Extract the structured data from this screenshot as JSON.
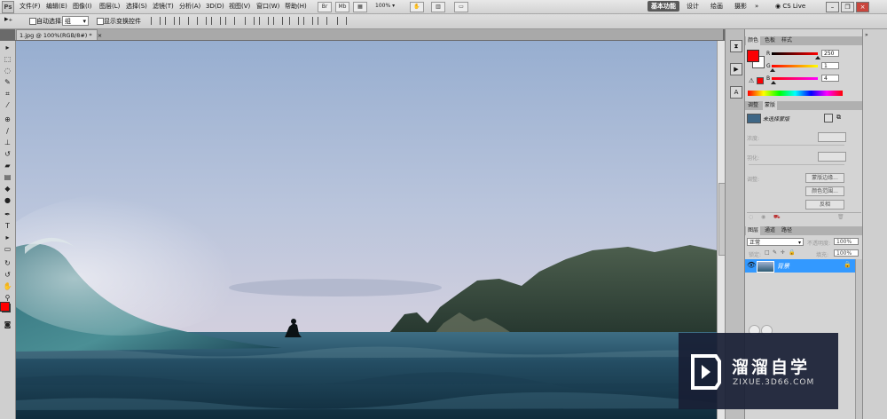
{
  "menubar": {
    "logo": "Ps",
    "menus": [
      "文件(F)",
      "编辑(E)",
      "图像(I)",
      "图层(L)",
      "选择(S)",
      "滤镜(T)",
      "分析(A)",
      "3D(D)",
      "视图(V)",
      "窗口(W)",
      "帮助(H)"
    ],
    "br_label": "Br",
    "mb_label": "Mb",
    "zoom": "100%",
    "workspaces": [
      "基本功能",
      "设计",
      "绘画",
      "摄影"
    ],
    "more": "»",
    "cs_live": "CS Live"
  },
  "options": {
    "auto_select_label": "自动选择:",
    "auto_select_value": "组",
    "show_transform_label": "显示变换控件"
  },
  "document": {
    "tab_title": "1.jpg @ 100%(RGB/8#) *",
    "tab_close": "×"
  },
  "color_panel": {
    "tabs": [
      "颜色",
      "色板",
      "样式"
    ],
    "channels": [
      {
        "label": "R",
        "value": "250",
        "pos": 1.0
      },
      {
        "label": "G",
        "value": "1",
        "pos": 0.0
      },
      {
        "label": "B",
        "value": "4",
        "pos": 0.02
      }
    ],
    "foreground": "#fa0104"
  },
  "adjust_panel": {
    "tabs": [
      "调整",
      "蒙版"
    ],
    "mask_label": "未选择蒙版",
    "density_label": "浓度:",
    "feather_label": "羽化:",
    "refine_label": "调整:",
    "buttons": [
      "蒙版边缘...",
      "颜色范围...",
      "反相"
    ]
  },
  "layers_panel": {
    "tabs": [
      "图层",
      "通道",
      "路径"
    ],
    "blend_mode": "正常",
    "opacity_label": "不透明度:",
    "opacity_value": "100%",
    "lock_label": "锁定:",
    "fill_label": "填充:",
    "fill_value": "100%",
    "layer_name": "背景"
  },
  "watermark": {
    "title": "溜溜自学",
    "url": "ZIXUE.3D66.COM"
  },
  "colors": {
    "accent": "#3399ff",
    "foreground": "#ff0000"
  }
}
